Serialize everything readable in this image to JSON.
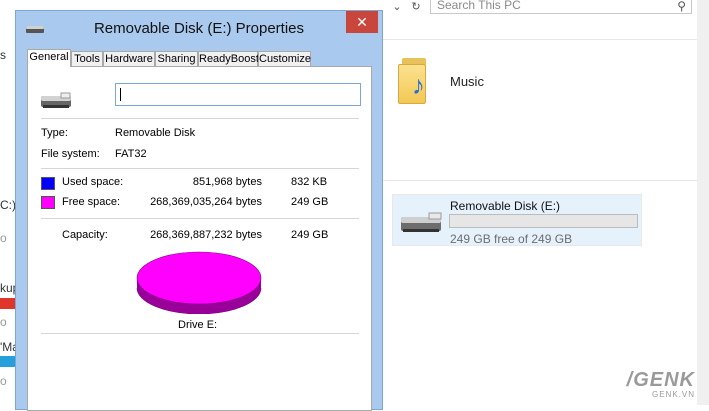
{
  "explorer": {
    "search_placeholder": "Search This PC",
    "music_label": "Music",
    "drive_tile": {
      "name": "Removable Disk (E:)",
      "free_text": "249 GB free of 249 GB",
      "used_fraction": 0.0
    },
    "left_fragments": [
      "s",
      "C:)",
      "o",
      "kup",
      "o",
      "'Ma",
      "o"
    ],
    "watermark": {
      "logo": "/GENK",
      "sub": "GENK.VN"
    }
  },
  "dialog": {
    "title": "Removable Disk (E:) Properties",
    "close_glyph": "✕",
    "tabs": [
      "General",
      "Tools",
      "Hardware",
      "Sharing",
      "ReadyBoost",
      "Customize"
    ],
    "active_tab": "General",
    "label_value": "",
    "type_label": "Type:",
    "type_value": "Removable Disk",
    "fs_label": "File system:",
    "fs_value": "FAT32",
    "used": {
      "label": "Used space:",
      "bytes": "851,968 bytes",
      "size": "832 KB",
      "color": "#0000ff"
    },
    "free": {
      "label": "Free space:",
      "bytes": "268,369,035,264 bytes",
      "size": "249 GB",
      "color": "#ff00ff"
    },
    "capacity": {
      "label": "Capacity:",
      "bytes": "268,369,887,232 bytes",
      "size": "249 GB"
    },
    "drive_label": "Drive E:"
  },
  "colors": {
    "accent": "#a9caee",
    "close": "#c9463d",
    "selected_tile": "#e5f1fb"
  }
}
